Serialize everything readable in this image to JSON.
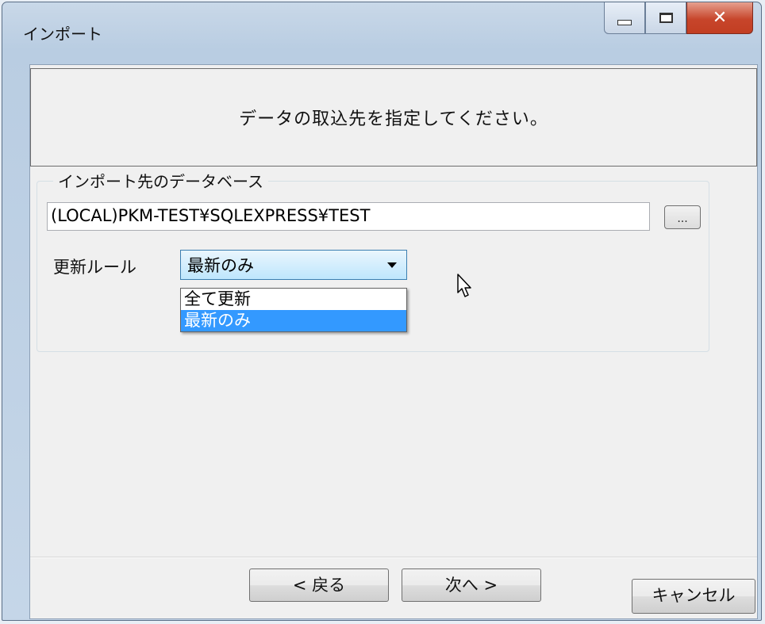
{
  "window": {
    "title": "インポート"
  },
  "header": {
    "instruction": "データの取込先を指定してください。"
  },
  "group": {
    "title": "インポート先のデータベース",
    "database_value": "(LOCAL)PKM-TEST¥SQLEXPRESS¥TEST",
    "browse_label": "..."
  },
  "rule": {
    "label": "更新ルール",
    "selected": "最新のみ",
    "options": [
      "全て更新",
      "最新のみ"
    ]
  },
  "buttons": {
    "back": "< 戻る",
    "next": "次へ >",
    "cancel": "キャンセル"
  },
  "icons": {
    "minimize": "minimize-icon",
    "maximize": "maximize-icon",
    "close": "close-icon",
    "cursor": "mouse-pointer-icon"
  }
}
